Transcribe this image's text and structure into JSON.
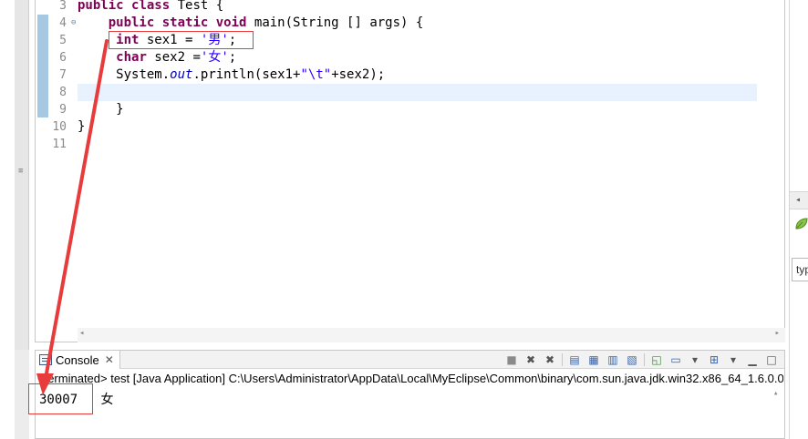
{
  "editor": {
    "lines": [
      {
        "num": "3",
        "indent": "",
        "tokens": [
          {
            "t": "public",
            "c": "kw"
          },
          {
            "t": " ",
            "c": ""
          },
          {
            "t": "class",
            "c": "kw"
          },
          {
            "t": " Test {",
            "c": ""
          }
        ]
      },
      {
        "num": "4",
        "indent": "    ",
        "tokens": [
          {
            "t": "public",
            "c": "kw"
          },
          {
            "t": " ",
            "c": ""
          },
          {
            "t": "static",
            "c": "kw"
          },
          {
            "t": " ",
            "c": ""
          },
          {
            "t": "void",
            "c": "kw"
          },
          {
            "t": " main(String [] args) {",
            "c": ""
          }
        ]
      },
      {
        "num": "5",
        "indent": "     ",
        "tokens": [
          {
            "t": "int",
            "c": "kw"
          },
          {
            "t": " sex1 = ",
            "c": ""
          },
          {
            "t": "'男'",
            "c": "str"
          },
          {
            "t": ";",
            "c": ""
          }
        ]
      },
      {
        "num": "6",
        "indent": "     ",
        "tokens": [
          {
            "t": "char",
            "c": "kw"
          },
          {
            "t": " sex2 =",
            "c": ""
          },
          {
            "t": "'女'",
            "c": "str"
          },
          {
            "t": ";",
            "c": ""
          }
        ]
      },
      {
        "num": "7",
        "indent": "     ",
        "tokens": [
          {
            "t": "System.",
            "c": ""
          },
          {
            "t": "out",
            "c": "fld"
          },
          {
            "t": ".println(sex1+",
            "c": ""
          },
          {
            "t": "\"\\t\"",
            "c": "str"
          },
          {
            "t": "+sex2);",
            "c": ""
          }
        ]
      },
      {
        "num": "8",
        "indent": "",
        "tokens": []
      },
      {
        "num": "9",
        "indent": "     ",
        "tokens": [
          {
            "t": "}",
            "c": ""
          }
        ]
      },
      {
        "num": "10",
        "indent": "",
        "tokens": [
          {
            "t": "}",
            "c": ""
          }
        ]
      },
      {
        "num": "11",
        "indent": "",
        "tokens": []
      }
    ],
    "fold_marker": "⊖"
  },
  "console": {
    "tab_label": "Console",
    "tab_close": "✕",
    "status": "<terminated> test [Java Application] C:\\Users\\Administrator\\AppData\\Local\\MyEclipse\\Common\\binary\\com.sun.java.jdk.win32.x86_64_1.6.0.0",
    "output_value": "30007",
    "output_char": "女"
  },
  "right_panel": {
    "field_text": "typ"
  },
  "colors": {
    "keyword": "#7f0055",
    "string": "#2a00ff",
    "field": "#0000c0",
    "highlight_red": "#e83b3b",
    "current_line": "#e8f2fe"
  },
  "icons": {
    "toolbar": [
      "terminate-icon",
      "remove-launch-icon",
      "remove-all-terminated-icon",
      "scroll-lock-icon",
      "show-on-output-icon",
      "show-on-error-icon",
      "word-wrap-icon",
      "pin-console-icon",
      "display-console-icon",
      "open-console-icon",
      "minimize-icon",
      "maximize-icon"
    ]
  }
}
